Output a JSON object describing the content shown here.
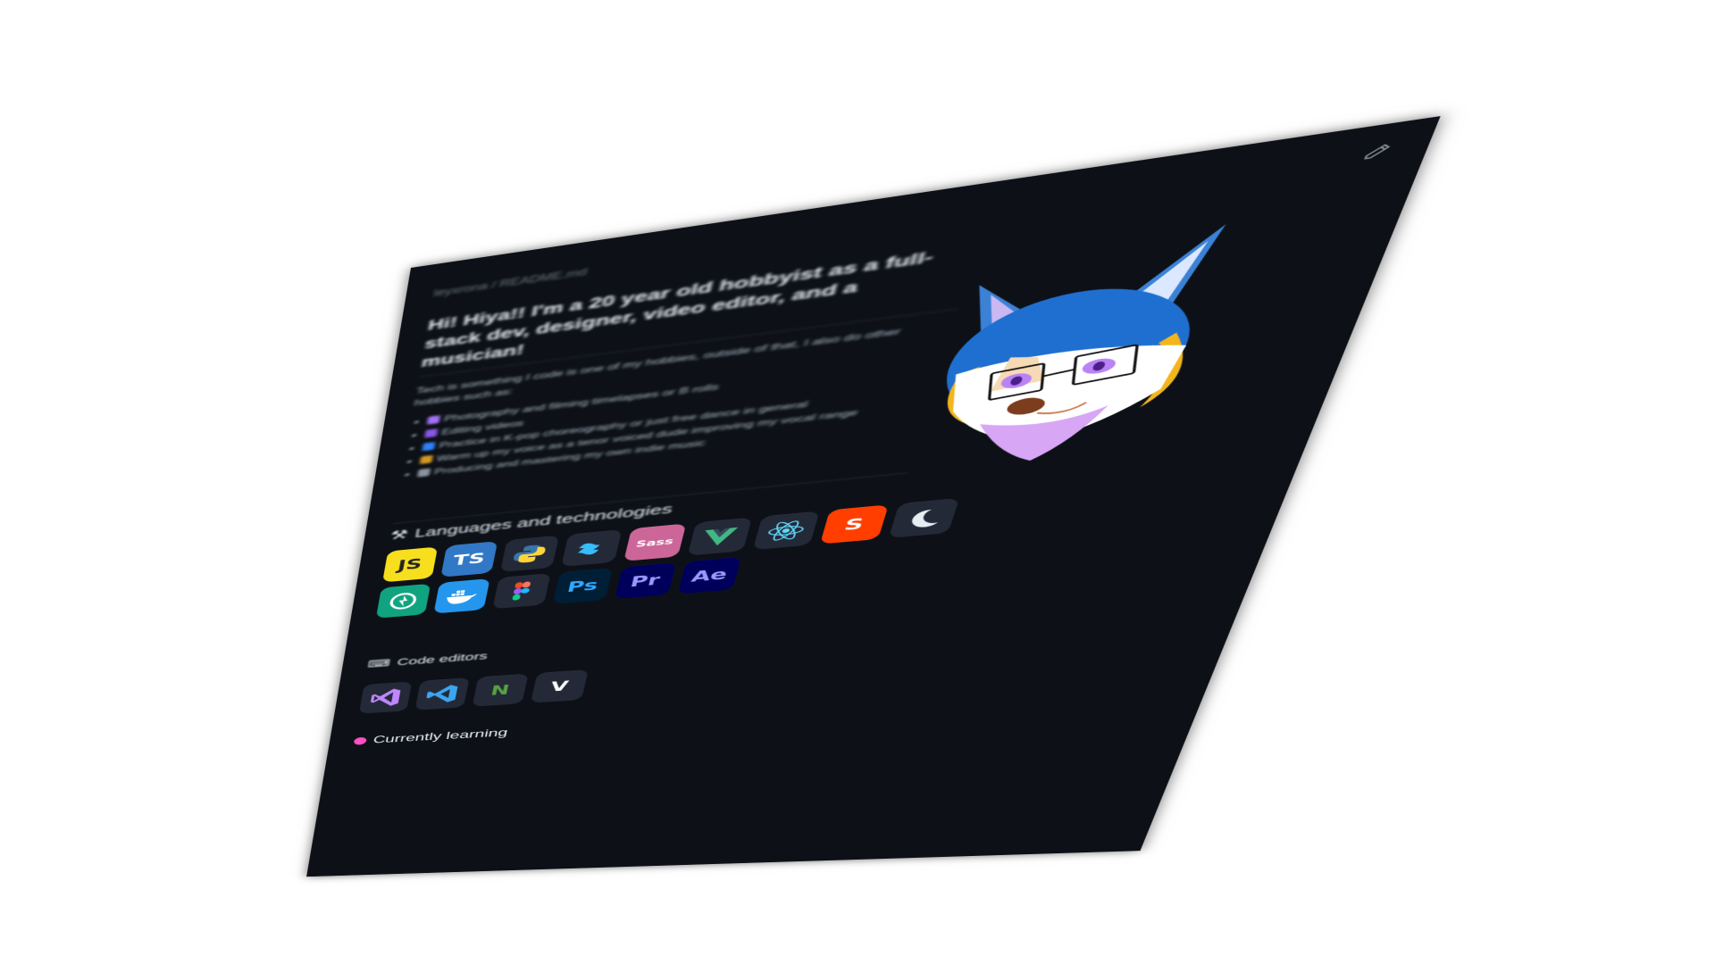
{
  "readme": {
    "path_label": "leyxrona / README.md",
    "heading": "Hi! Hiya!! I'm a 20 year old hobbyist as a full-stack dev, designer, video editor, and a musician!",
    "intro_text": "Tech is something I code is one of my hobbies, outside of that, I also do other hobbies such as:",
    "hobbies": [
      {
        "text": "Photography and filming timelapses or B rolls",
        "color": "#a371f7"
      },
      {
        "text": "Editing videos",
        "color": "#8957e5"
      },
      {
        "text": "Practice in K-pop choreography or just free dance in general",
        "color": "#2f81f7"
      },
      {
        "text": "Warm up my voice as a tenor voiced dude improving my vocal range",
        "color": "#d29922"
      },
      {
        "text": "Producing and mastering my own indie music",
        "color": "#8b949e"
      }
    ],
    "languages_title": "Languages and technologies",
    "editors_title": "Code editors",
    "learning_title": "Currently learning",
    "languages": [
      {
        "name": "javascript-icon",
        "label": "JS",
        "bg": "#f7df1e",
        "fg": "#222222"
      },
      {
        "name": "typescript-icon",
        "label": "TS",
        "bg": "#3178c6",
        "fg": "#ffffff"
      },
      {
        "name": "python-icon",
        "label": "",
        "bg": "#242938",
        "fg": "#ffffff"
      },
      {
        "name": "tailwind-icon",
        "label": "",
        "bg": "#242938",
        "fg": "#38bdf8"
      },
      {
        "name": "sass-icon",
        "label": "Sass",
        "bg": "#cc6699",
        "fg": "#ffffff"
      },
      {
        "name": "vue-icon",
        "label": "",
        "bg": "#242938",
        "fg": "#41b883"
      },
      {
        "name": "react-icon",
        "label": "",
        "bg": "#242938",
        "fg": "#61dafb"
      },
      {
        "name": "svelte-icon",
        "label": "S",
        "bg": "#ff3e00",
        "fg": "#ffffff"
      },
      {
        "name": "nextjs-moon-icon",
        "label": "",
        "bg": "#242938",
        "fg": "#e6edf3"
      },
      {
        "name": "openai-icon",
        "label": "",
        "bg": "#10a37f",
        "fg": "#ffffff"
      },
      {
        "name": "docker-icon",
        "label": "",
        "bg": "#2496ed",
        "fg": "#ffffff"
      },
      {
        "name": "figma-icon",
        "label": "",
        "bg": "#242938",
        "fg": "#ffffff"
      },
      {
        "name": "photoshop-icon",
        "label": "Ps",
        "bg": "#001e36",
        "fg": "#31a8ff"
      },
      {
        "name": "premiere-icon",
        "label": "Pr",
        "bg": "#00005b",
        "fg": "#9999ff"
      },
      {
        "name": "aftereffects-icon",
        "label": "Ae",
        "bg": "#00005b",
        "fg": "#9999ff"
      }
    ],
    "editors": [
      {
        "name": "visual-studio-icon",
        "label": "",
        "bg": "#242938",
        "fg": "#c086ff"
      },
      {
        "name": "vscode-icon",
        "label": "",
        "bg": "#242938",
        "fg": "#3ba5f0"
      },
      {
        "name": "neovim-icon",
        "label": "N",
        "bg": "#242938",
        "fg": "#57a143"
      },
      {
        "name": "vim-icon",
        "label": "V",
        "bg": "#242938",
        "fg": "#ffffff"
      }
    ]
  }
}
